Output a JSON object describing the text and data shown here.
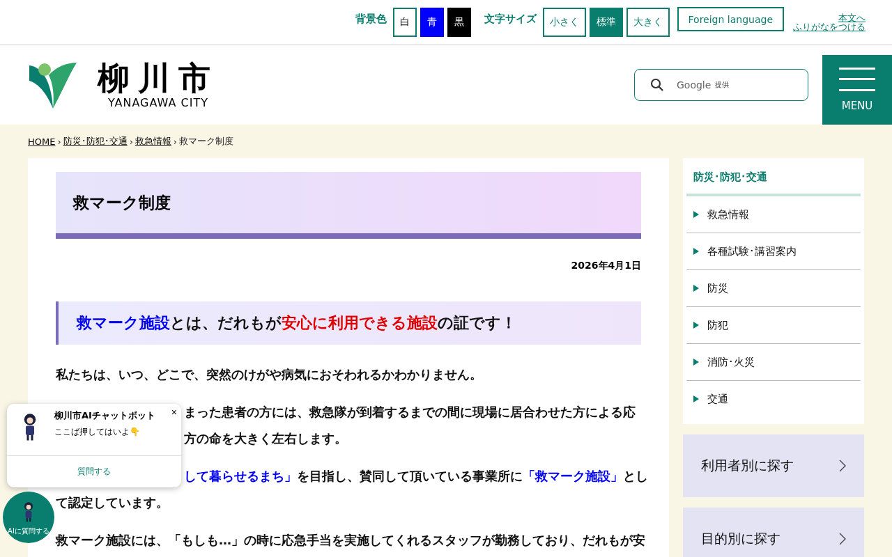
{
  "utility_bar": {
    "background_label": "背景色",
    "background_options": [
      {
        "label": "白",
        "kind": "white"
      },
      {
        "label": "青",
        "kind": "blue"
      },
      {
        "label": "黒",
        "kind": "black"
      }
    ],
    "text_size_label": "文字サイズ",
    "text_sizes": [
      {
        "label": "小さく",
        "selected": false
      },
      {
        "label": "標準",
        "selected": true
      },
      {
        "label": "大きく",
        "selected": false
      }
    ],
    "foreign_language": "Foreign language",
    "skip_links": [
      "本文へ",
      "ふりがなをつける"
    ]
  },
  "header": {
    "logo_name": "柳川市",
    "logo_subtitle": "YANAGAWA CITY",
    "search": {
      "provider": "Google",
      "provider_note": "提供"
    },
    "menu_label": "MENU"
  },
  "breadcrumb": [
    {
      "label": "HOME",
      "link": true
    },
    {
      "separator": "›",
      "label": "防災･防犯･交通",
      "link": true
    },
    {
      "separator": "›",
      "label": "救急情報",
      "link": true
    },
    {
      "separator": "›",
      "label": "救マーク制度",
      "link": false
    }
  ],
  "article": {
    "title": "救マーク制度",
    "date": "2026年4月1日",
    "lead": [
      {
        "text": "救マーク施設",
        "kind": "blue"
      },
      {
        "text": "とは、だれもが",
        "kind": "plain"
      },
      {
        "text": "安心に利用できる施設",
        "kind": "red"
      },
      {
        "text": "の証です！",
        "kind": "plain"
      }
    ],
    "paragraphs": [
      {
        "lines": [
          {
            "segments": [
              {
                "text": "私たちは、いつ、どこで、突然のけがや病気におそわれるかわかりません。",
                "kind": "plain"
              }
            ]
          }
        ]
      },
      {
        "lines": [
          {
            "covered_start": true,
            "segments": [
              {
                "text": "まった患者の方には、救急隊が到着するまでの間に現場に居合わせた方による応",
                "kind": "plain"
              }
            ]
          },
          {
            "covered_start": true,
            "segments": [
              {
                "text": "方の命を大きく左右します。",
                "kind": "plain"
              }
            ]
          }
        ]
      },
      {
        "lines": [
          {
            "covered_start": true,
            "segments": [
              {
                "text": "して暮らせるまち」",
                "kind": "blue"
              },
              {
                "text": "を目指し、賛同して頂いている事業所に",
                "kind": "plain"
              },
              {
                "text": "「救マーク施設」",
                "kind": "blue"
              },
              {
                "text": "とし",
                "kind": "plain"
              }
            ]
          },
          {
            "segments": [
              {
                "text": "て認定しています。",
                "kind": "plain"
              }
            ]
          }
        ]
      },
      {
        "lines": [
          {
            "segments": [
              {
                "text": "救マーク施設には、「もしも…」の時に応急手当を実施してくれるスタッフが勤務しており、だれもが安",
                "kind": "plain"
              }
            ]
          }
        ]
      }
    ]
  },
  "sidebar": {
    "heading": "防災･防犯･交通",
    "items": [
      "救急情報",
      "各種試験･講習案内",
      "防災",
      "防犯",
      "消防･火災",
      "交通"
    ],
    "cards": [
      "利用者別に探す",
      "目的別に探す"
    ]
  },
  "chatbot": {
    "title": "柳川市AIチャットボット",
    "close": "×",
    "message": "ここば押してはいよ👇",
    "action": "質問する",
    "launcher_label": "AIに質問する"
  }
}
